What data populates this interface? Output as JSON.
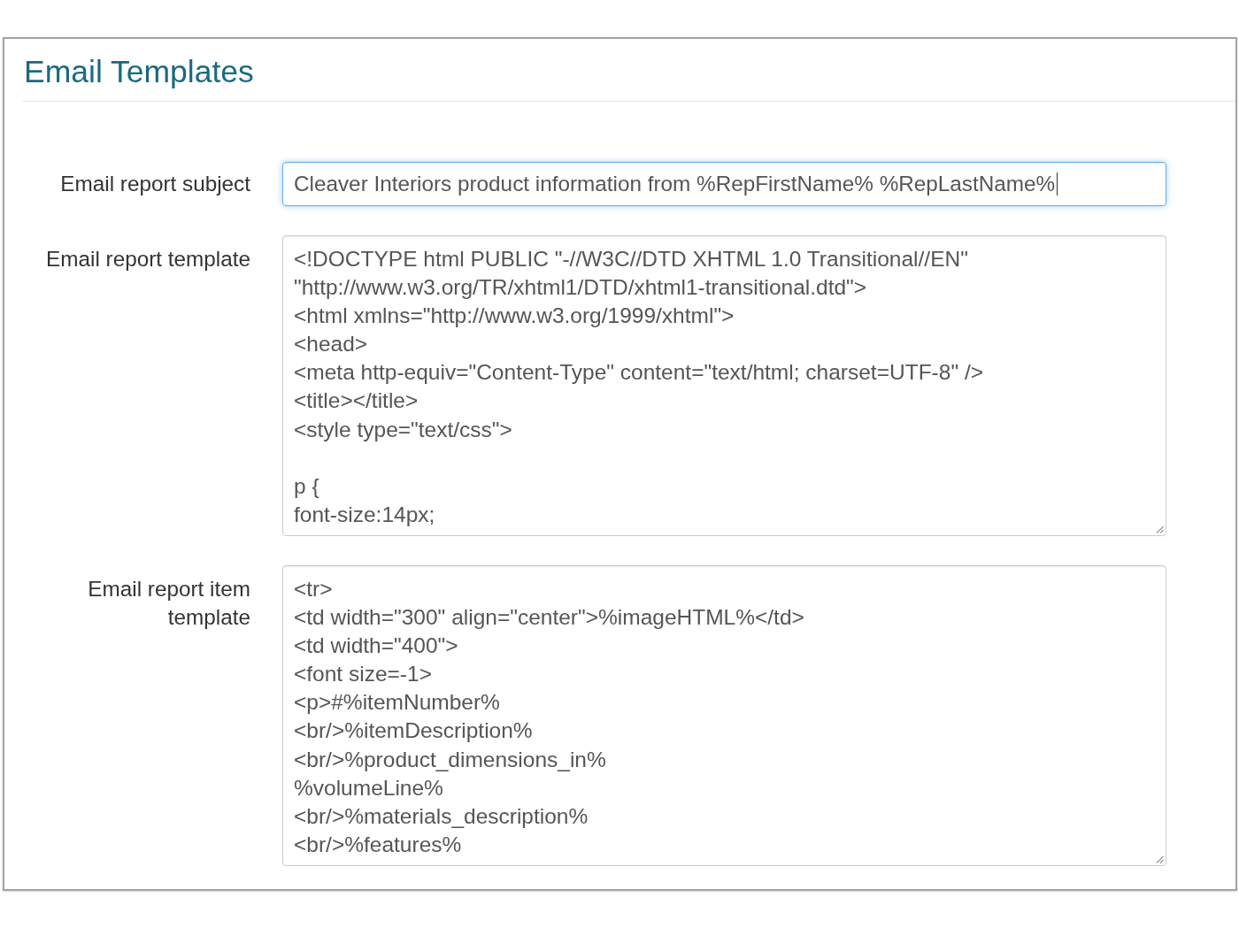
{
  "page": {
    "title": "Email Templates"
  },
  "form": {
    "fields": [
      {
        "kind": "input",
        "label": "Email report subject",
        "value": "Cleaver Interiors product information from %RepFirstName% %RepLastName%",
        "focused": true
      },
      {
        "kind": "textarea",
        "label": "Email report template",
        "value": "<!DOCTYPE html PUBLIC \"-//W3C//DTD XHTML 1.0 Transitional//EN\"\n\"http://www.w3.org/TR/xhtml1/DTD/xhtml1-transitional.dtd\">\n<html xmlns=\"http://www.w3.org/1999/xhtml\">\n<head>\n<meta http-equiv=\"Content-Type\" content=\"text/html; charset=UTF-8\" />\n<title></title>\n<style type=\"text/css\">\n\np {\nfont-size:14px;",
        "focused": false
      },
      {
        "kind": "textarea",
        "label": "Email report item template",
        "value": "<tr>\n<td width=\"300\" align=\"center\">%imageHTML%</td>\n<td width=\"400\">\n<font size=-1>\n<p>#%itemNumber%\n<br/>%itemDescription%\n<br/>%product_dimensions_in%\n%volumeLine%\n<br/>%materials_description%\n<br/>%features%",
        "focused": false
      }
    ]
  }
}
